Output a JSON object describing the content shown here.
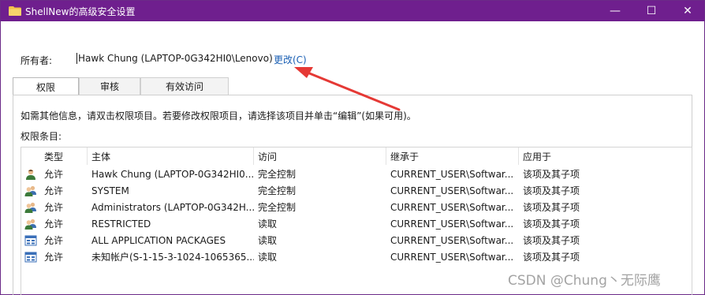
{
  "window": {
    "title": "ShellNew的高级安全设置",
    "folder_icon": "folder-icon",
    "minimize_glyph": "—",
    "maximize_glyph": "☐",
    "close_glyph": "✕",
    "titlebar_color": "#6f1f8e"
  },
  "owner": {
    "label": "所有者:",
    "value": "Hawk Chung (LAPTOP-0G342HI0\\Lenovo)",
    "change_link": "更改(C)",
    "link_color": "#1a5fb4"
  },
  "tabs": [
    {
      "label": "权限",
      "active": true
    },
    {
      "label": "审核",
      "active": false
    },
    {
      "label": "有效访问",
      "active": false
    }
  ],
  "info_text": "如需其他信息，请双击权限项目。若要修改权限项目，请选择该项目并单击“编辑”(如果可用)。",
  "entries_label": "权限条目:",
  "table": {
    "columns": [
      "类型",
      "主体",
      "访问",
      "继承于",
      "应用于"
    ],
    "rows": [
      {
        "icon": "user-icon",
        "type": "允许",
        "principal": "Hawk Chung (LAPTOP-0G342HI0...",
        "access": "完全控制",
        "inherited_from": "CURRENT_USER\\Softwar...",
        "applies_to": "该项及其子项"
      },
      {
        "icon": "group-icon",
        "type": "允许",
        "principal": "SYSTEM",
        "access": "完全控制",
        "inherited_from": "CURRENT_USER\\Softwar...",
        "applies_to": "该项及其子项"
      },
      {
        "icon": "group-icon",
        "type": "允许",
        "principal": "Administrators (LAPTOP-0G342H...",
        "access": "完全控制",
        "inherited_from": "CURRENT_USER\\Softwar...",
        "applies_to": "该项及其子项"
      },
      {
        "icon": "group-icon",
        "type": "允许",
        "principal": "RESTRICTED",
        "access": "读取",
        "inherited_from": "CURRENT_USER\\Softwar...",
        "applies_to": "该项及其子项"
      },
      {
        "icon": "package-icon",
        "type": "允许",
        "principal": "ALL APPLICATION PACKAGES",
        "access": "读取",
        "inherited_from": "CURRENT_USER\\Softwar...",
        "applies_to": "该项及其子项"
      },
      {
        "icon": "package-icon",
        "type": "允许",
        "principal": "未知帐户(S-1-15-3-1024-1065365...",
        "access": "读取",
        "inherited_from": "CURRENT_USER\\Softwar...",
        "applies_to": "该项及其子项"
      }
    ]
  },
  "annotation": {
    "arrow_color": "#e53935"
  },
  "watermark": "CSDN @Chung丶无际鹰"
}
